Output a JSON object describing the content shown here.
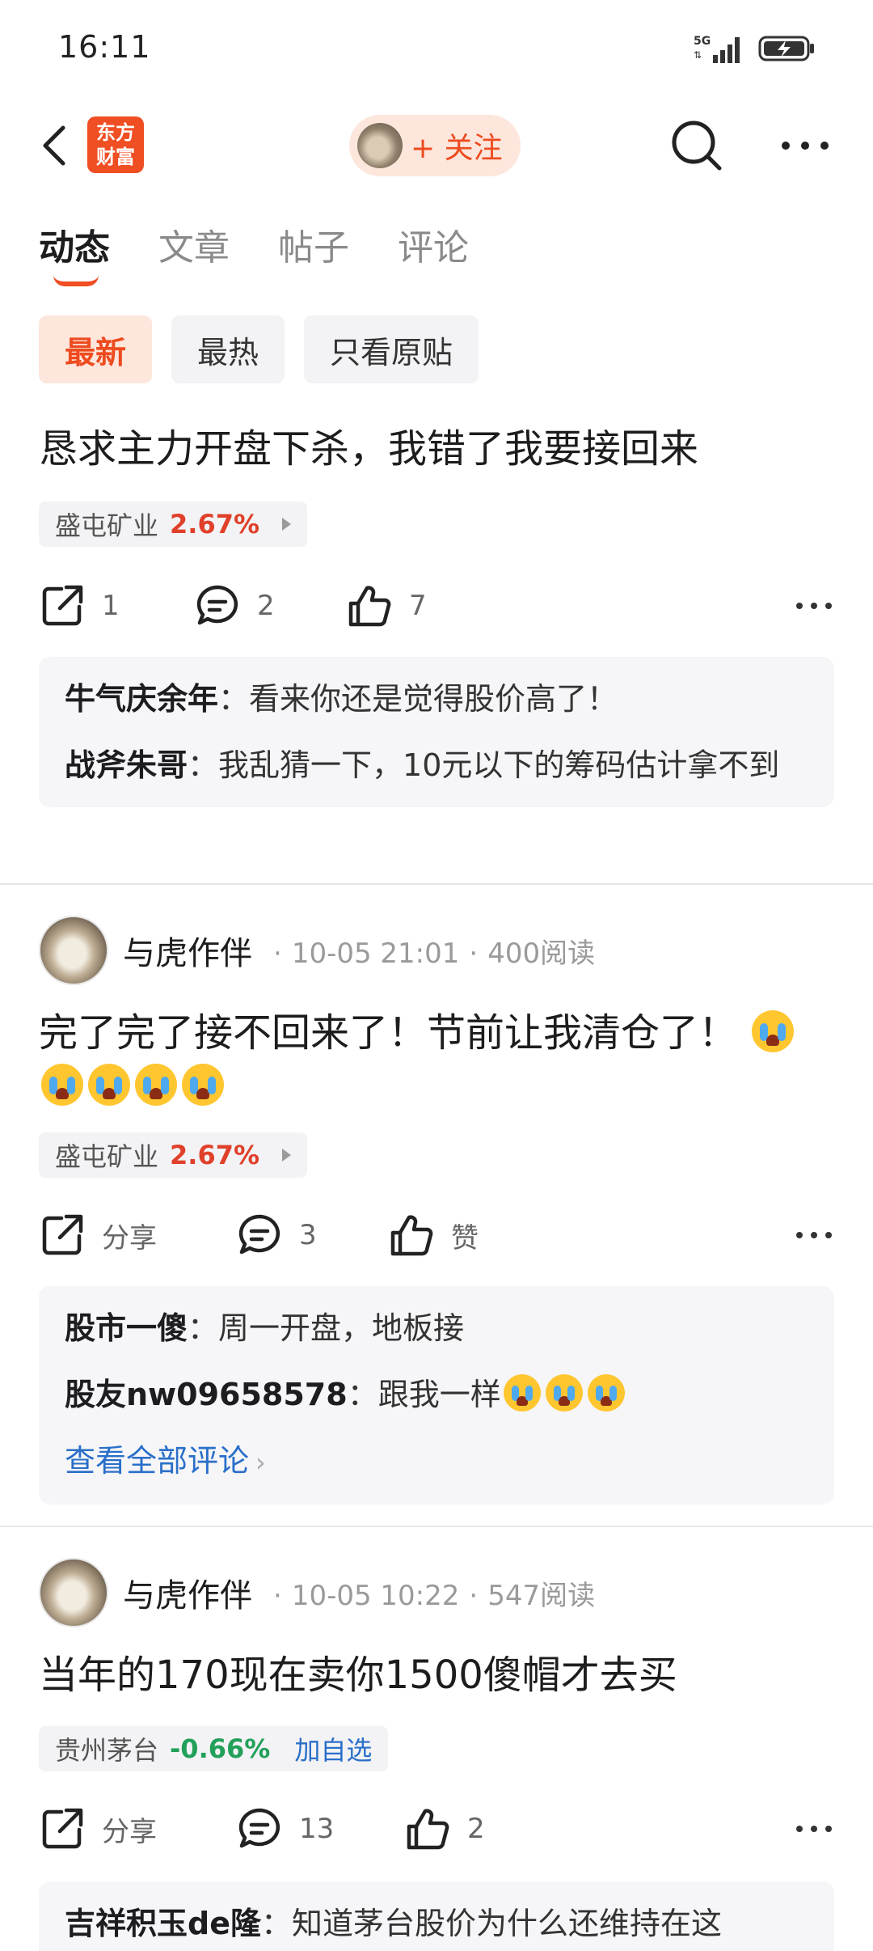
{
  "status": {
    "time": "16:11",
    "network": "5G"
  },
  "nav": {
    "logo_line1": "东方",
    "logo_line2": "财富",
    "follow_label": "+ 关注"
  },
  "tabs": [
    {
      "label": "动态",
      "active": true
    },
    {
      "label": "文章",
      "active": false
    },
    {
      "label": "帖子",
      "active": false
    },
    {
      "label": "评论",
      "active": false
    }
  ],
  "filters": [
    {
      "label": "最新",
      "active": true
    },
    {
      "label": "最热",
      "active": false
    },
    {
      "label": "只看原贴",
      "active": false
    }
  ],
  "posts": [
    {
      "title": "恳求主力开盘下杀，我错了我要接回来",
      "stock": {
        "name": "盛屯矿业",
        "change": "2.67%",
        "direction": "up"
      },
      "actions": {
        "share": "1",
        "comment": "2",
        "like": "7"
      },
      "comments": [
        {
          "author": "牛气庆余年",
          "text": "看来你还是觉得股价高了！"
        },
        {
          "author": "战斧朱哥",
          "text": "我乱猜一下，10元以下的筹码估计拿不到"
        }
      ]
    },
    {
      "author": "与虎作伴",
      "time": "10-05 21:01",
      "reads": "400阅读",
      "title": "完了完了接不回来了！节前让我清仓了！",
      "stock": {
        "name": "盛屯矿业",
        "change": "2.67%",
        "direction": "up"
      },
      "actions": {
        "share": "分享",
        "comment": "3",
        "like": "赞"
      },
      "comments": [
        {
          "author": "股市一傻",
          "text": "周一开盘，地板接"
        },
        {
          "author": "股友nw09658578",
          "text": "跟我一样"
        }
      ],
      "see_all": "查看全部评论"
    },
    {
      "author": "与虎作伴",
      "time": "10-05 10:22",
      "reads": "547阅读",
      "title": "当年的170现在卖你1500傻帽才去买",
      "stock": {
        "name": "贵州茅台",
        "change": "-0.66%",
        "direction": "down",
        "add_watch": "加自选"
      },
      "actions": {
        "share": "分享",
        "comment": "13",
        "like": "2"
      },
      "comments": [
        {
          "author": "吉祥积玉de隆",
          "text": "知道茅台股价为什么还维持在这"
        }
      ]
    }
  ],
  "colors": {
    "accent": "#f04e23",
    "up": "#e0402a",
    "down": "#22a05a",
    "link": "#2a6fc9"
  },
  "icons": [
    "back-arrow-icon",
    "search-icon",
    "more-icon",
    "share-icon",
    "comment-icon",
    "thumbs-up-icon",
    "crying-emoji-icon"
  ]
}
